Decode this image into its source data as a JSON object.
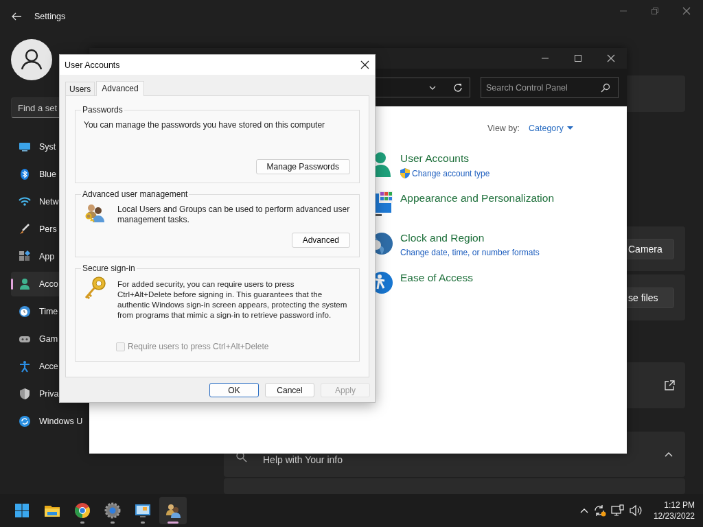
{
  "settings": {
    "title": "Settings",
    "search": {
      "placeholder": "Find a set"
    },
    "nav_items": [
      {
        "label": "Syst",
        "selected": false
      },
      {
        "label": "Blue",
        "selected": false
      },
      {
        "label": "Netw",
        "selected": false
      },
      {
        "label": "Pers",
        "selected": false
      },
      {
        "label": "App",
        "selected": false
      },
      {
        "label": "Acco",
        "selected": true
      },
      {
        "label": "Time",
        "selected": false
      },
      {
        "label": "Gam",
        "selected": false
      },
      {
        "label": "Acce",
        "selected": false
      },
      {
        "label": "Priva",
        "selected": false
      },
      {
        "label": "Windows U",
        "selected": false
      }
    ],
    "cards": [
      {
        "kind": "blank"
      },
      {
        "kind": "button",
        "label": "Camera"
      },
      {
        "kind": "button",
        "label": "se files"
      },
      {
        "kind": "link"
      },
      {
        "kind": "expander",
        "label": "Help with Your info",
        "expanded": true
      },
      {
        "kind": "blank"
      }
    ]
  },
  "control_panel": {
    "search": {
      "placeholder": "Search Control Panel"
    },
    "view_by": {
      "label": "View by:",
      "value": "Category"
    },
    "categories": [
      {
        "title": "User Accounts",
        "links": [
          {
            "text": "Change account type",
            "kind": "admin"
          }
        ]
      },
      {
        "title": "Appearance and Personalization"
      },
      {
        "title": "Clock and Region",
        "links": [
          {
            "text": "Change date, time, or number formats",
            "kind": "plain"
          }
        ]
      },
      {
        "title": "Ease of Access"
      }
    ]
  },
  "dialog": {
    "title": "User Accounts",
    "tabs": [
      {
        "label": "Users",
        "selected": false
      },
      {
        "label": "Advanced",
        "selected": true
      }
    ],
    "groups": [
      {
        "title": "Passwords",
        "text": "You can manage the passwords you have stored on this computer",
        "button": "Manage Passwords"
      },
      {
        "title": "Advanced user management",
        "text": "Local Users and Groups can be used to perform advanced user management tasks.",
        "button": "Advanced"
      },
      {
        "title": "Secure sign-in",
        "text": "For added security, you can require users to press Ctrl+Alt+Delete before signing in. This guarantees that the authentic Windows sign-in screen appears, protecting the system from programs that mimic a sign-in to retrieve password info.",
        "checkbox": {
          "label": "Require users to press Ctrl+Alt+Delete",
          "checked": false,
          "disabled": true
        }
      }
    ],
    "buttons": [
      {
        "label": "OK",
        "default": true,
        "disabled": false
      },
      {
        "label": "Cancel",
        "default": false,
        "disabled": false
      },
      {
        "label": "Apply",
        "default": false,
        "disabled": true
      }
    ]
  },
  "taskbar": {
    "apps": [
      {
        "running": false,
        "active": false
      },
      {
        "running": false,
        "active": false
      },
      {
        "running": true,
        "active": false
      },
      {
        "running": true,
        "active": false
      },
      {
        "running": true,
        "active": false
      },
      {
        "running": true,
        "active": true
      }
    ],
    "clock": {
      "time": "1:12 PM",
      "date": "12/23/2022"
    }
  }
}
